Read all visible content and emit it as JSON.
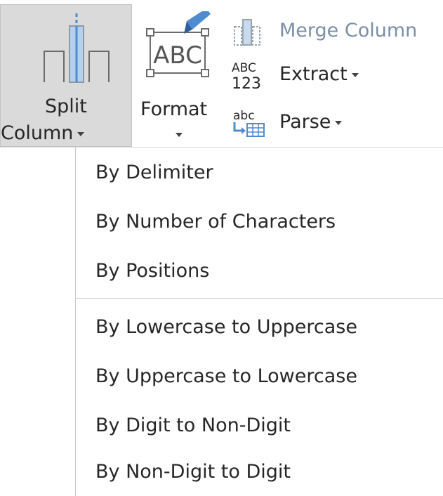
{
  "ribbon": {
    "split_column": {
      "line1": "Split",
      "line2": "Column",
      "icon": "split-column-icon"
    },
    "format": {
      "label": "Format",
      "icon": "format-abc-pen-icon"
    },
    "merge_columns": {
      "label": "Merge Column",
      "icon": "merge-columns-icon"
    },
    "extract": {
      "label": "Extract",
      "icon": "abc-123-icon"
    },
    "parse": {
      "label": "Parse",
      "icon": "parse-icon"
    }
  },
  "menu": {
    "group1": [
      {
        "label": "By Delimiter"
      },
      {
        "label": "By Number of Characters"
      },
      {
        "label": "By Positions"
      }
    ],
    "group2": [
      {
        "label": "By Lowercase to Uppercase"
      },
      {
        "label": "By Uppercase to Lowercase"
      },
      {
        "label": "By Digit to Non-Digit"
      },
      {
        "label": "By Non-Digit to Digit"
      }
    ]
  },
  "colors": {
    "pressed_background": "#dadada",
    "disabled_text": "#7a8fa6",
    "accent_blue": "#4f8ccf"
  }
}
